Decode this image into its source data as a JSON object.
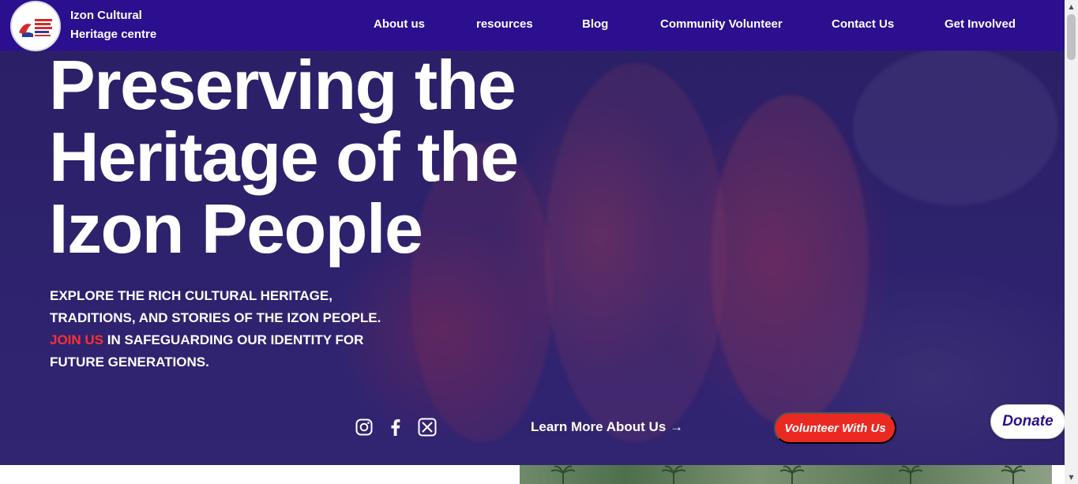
{
  "brand": {
    "name_line1": "Izon Cultural",
    "name_line2": "Heritage centre"
  },
  "nav": {
    "items": [
      {
        "label": "About us"
      },
      {
        "label": "resources"
      },
      {
        "label": "Blog"
      },
      {
        "label": "Community Volunteer"
      },
      {
        "label": "Contact Us"
      },
      {
        "label": "Get Involved"
      }
    ]
  },
  "hero": {
    "headline_line1": "Preserving the",
    "headline_line2": "Heritage of the",
    "headline_line3": "Izon People",
    "tagline_part1": "Explore the rich cultural heritage, traditions, and stories of the Izon people.",
    "tagline_accent": "Join us",
    "tagline_part2": "in safeguarding our identity for future generations.",
    "learn_more": "Learn More About Us →",
    "volunteer_button": "Volunteer With Us",
    "donate_button": "Donate"
  },
  "socials": {
    "icons": [
      "instagram-icon",
      "facebook-icon",
      "x-twitter-icon"
    ]
  },
  "colors": {
    "nav_background": "#2b0f8f",
    "hero_overlay": "#2c216a",
    "accent_red": "#ea2a22",
    "donate_text": "#2b0f8f"
  }
}
